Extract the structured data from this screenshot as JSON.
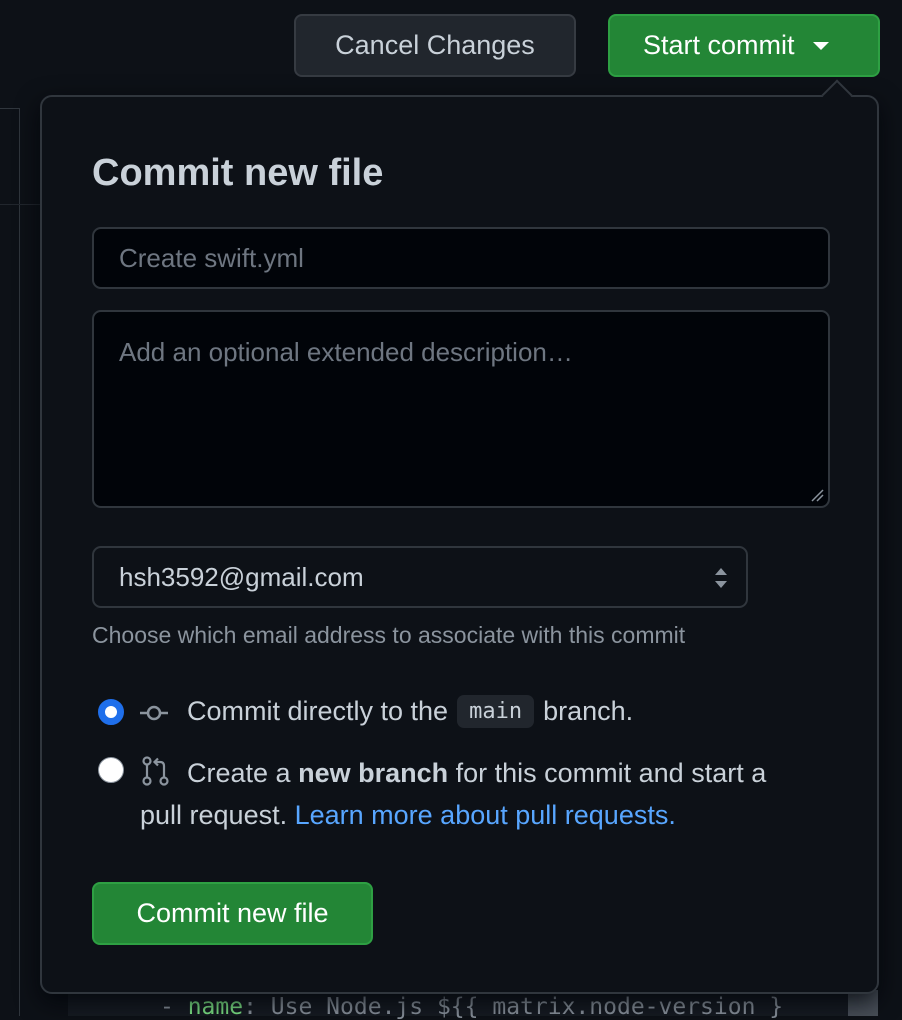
{
  "header": {
    "cancel_label": "Cancel Changes",
    "start_commit_label": "Start commit"
  },
  "popover": {
    "title": "Commit new file",
    "summary_placeholder": "Create swift.yml",
    "description_placeholder": "Add an optional extended description…",
    "email_selected": "hsh3592@gmail.com",
    "email_hint": "Choose which email address to associate with this commit",
    "option_direct": {
      "before": "Commit directly to the",
      "branch": "main",
      "after": "branch.",
      "selected": true
    },
    "option_new_branch": {
      "before": "Create a",
      "bold": "new branch",
      "after": "for this commit and start a",
      "line2": "pull request.",
      "link": "Learn more about pull requests.",
      "selected": false
    },
    "commit_label": "Commit new file"
  },
  "background": {
    "code_prefix": "- ",
    "code_key": "name",
    "code_rest": ": Use Node.js ${{ matrix.node-version }"
  },
  "colors": {
    "primary_green": "#238636",
    "link_blue": "#58a6ff",
    "radio_blue": "#1f6feb",
    "bg": "#0d1117"
  }
}
